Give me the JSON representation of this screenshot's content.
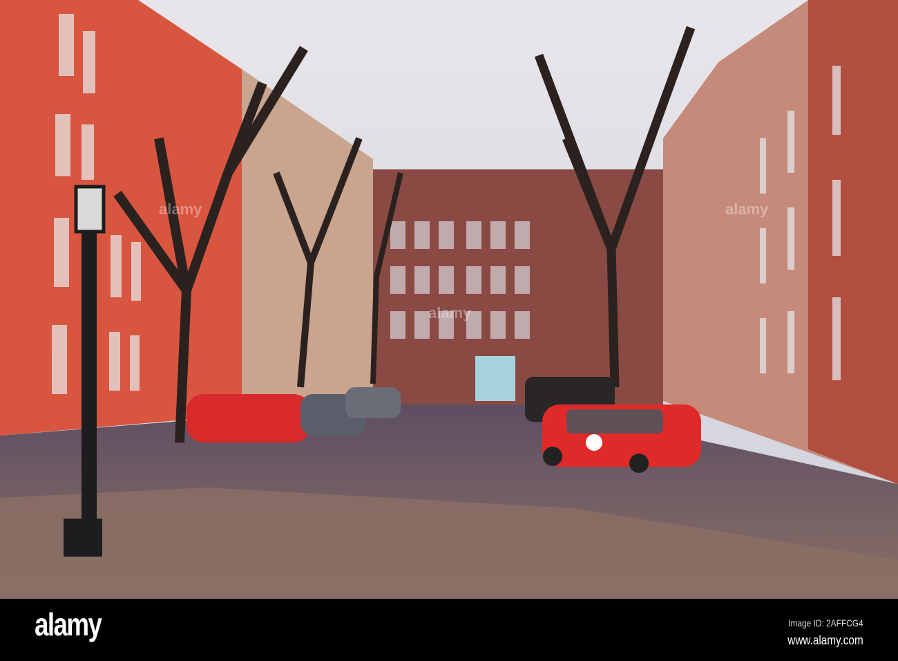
{
  "watermark": {
    "logo": "alamy",
    "image_id": "Image ID: 2AFFCG4",
    "website": "www.alamy.com"
  },
  "colors": {
    "sky": "#dcdde3",
    "left_building": "#d8553f",
    "right_building": "#c58a7a",
    "road": "#6a5560",
    "car": "#e02a2a"
  }
}
